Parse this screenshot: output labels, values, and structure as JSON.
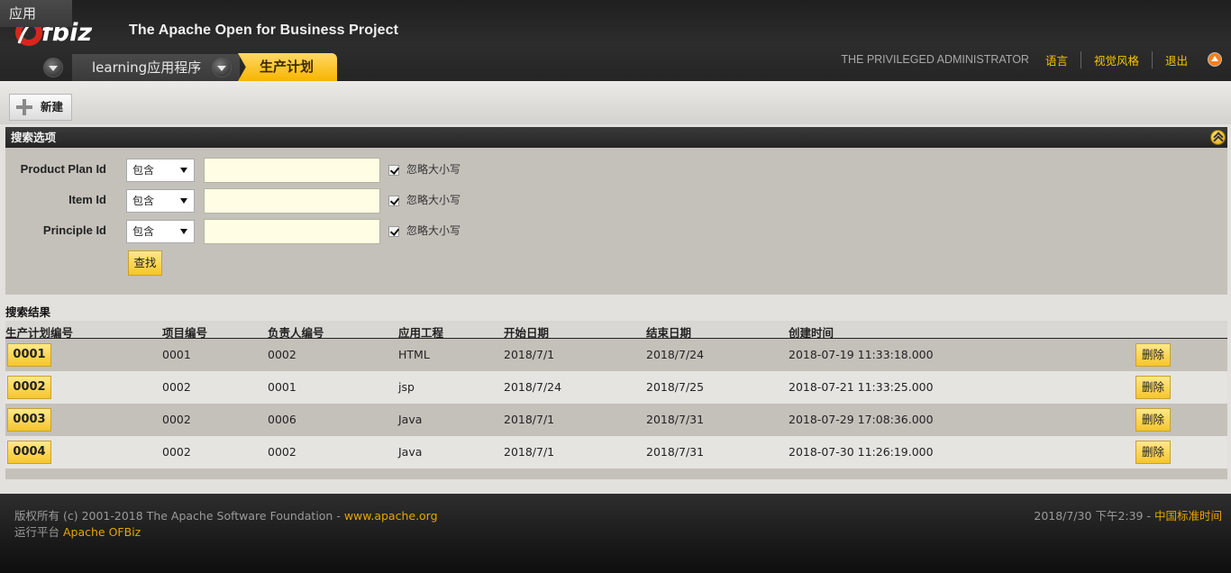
{
  "header": {
    "logo_text": "Ofbiz",
    "project_title": "The Apache Open for Business Project",
    "app_tabs": [
      {
        "label": "应用"
      },
      {
        "label": "learning应用程序"
      },
      {
        "label": "生产计划"
      }
    ],
    "user": {
      "name": "THE PRIVILEGED ADMINISTRATOR",
      "links": [
        "语言",
        "视觉风格",
        "退出"
      ]
    }
  },
  "toolbar": {
    "new_label": "新建"
  },
  "search": {
    "title": "搜索选项",
    "fields": [
      {
        "label": "Product Plan Id",
        "operator": "包含",
        "value": "",
        "ignore_case_label": "忽略大小写",
        "ignore_case": true
      },
      {
        "label": "Item Id",
        "operator": "包含",
        "value": "",
        "ignore_case_label": "忽略大小写",
        "ignore_case": true
      },
      {
        "label": "Principle Id",
        "operator": "包含",
        "value": "",
        "ignore_case_label": "忽略大小写",
        "ignore_case": true
      }
    ],
    "find_label": "查找"
  },
  "results": {
    "title": "搜索结果",
    "columns": [
      "生产计划编号",
      "项目编号",
      "负责人编号",
      "应用工程",
      "开始日期",
      "结束日期",
      "创建时间"
    ],
    "delete_label": "删除",
    "rows": [
      {
        "id": "0001",
        "item": "0001",
        "principle": "0002",
        "app": "HTML",
        "start": "2018/7/1",
        "end": "2018/7/24",
        "created": "2018-07-19 11:33:18.000"
      },
      {
        "id": "0002",
        "item": "0002",
        "principle": "0001",
        "app": "jsp",
        "start": "2018/7/24",
        "end": "2018/7/25",
        "created": "2018-07-21 11:33:25.000"
      },
      {
        "id": "0003",
        "item": "0002",
        "principle": "0006",
        "app": "Java",
        "start": "2018/7/1",
        "end": "2018/7/31",
        "created": "2018-07-29 17:08:36.000"
      },
      {
        "id": "0004",
        "item": "0002",
        "principle": "0002",
        "app": "Java",
        "start": "2018/7/1",
        "end": "2018/7/31",
        "created": "2018-07-30 11:26:19.000"
      }
    ]
  },
  "footer": {
    "copyright": "版权所有 (c) 2001-2018 The Apache Software Foundation - ",
    "apache_link": "www.apache.org",
    "powered_prefix": "运行平台 ",
    "powered_link": "Apache OFBiz",
    "datetime": "2018/7/30 下午2:39 - ",
    "timezone": "中国标准时间"
  },
  "colors": {
    "accent_yellow": "#f6c52b",
    "link_yellow": "#f5c500",
    "header_dark": "#2d2d2d",
    "input_bg": "#fffde3"
  }
}
